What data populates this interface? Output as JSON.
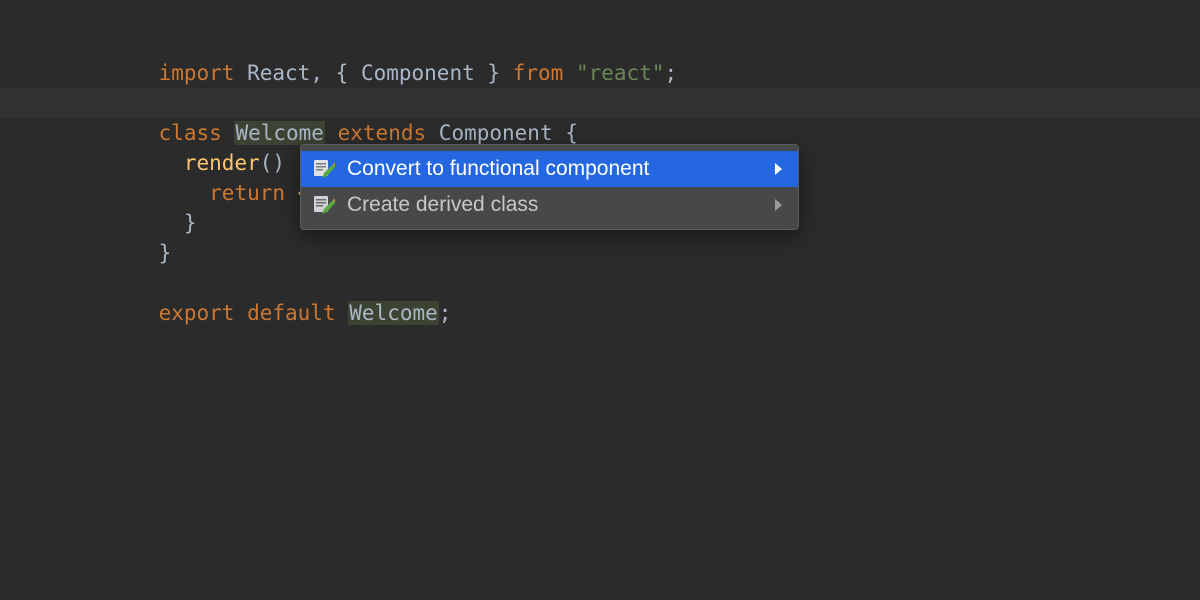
{
  "code": {
    "l1": {
      "kw_import": "import",
      "react": "React",
      "comma": ",",
      "lb": "{",
      "component": "Component",
      "rb": "}",
      "kw_from": "from",
      "str": "\"react\"",
      "semi": ";"
    },
    "l3": {
      "kw_class": "class",
      "name": "Welcome",
      "kw_extends": "extends",
      "super": "Component",
      "lb": "{"
    },
    "l4": {
      "method": "render",
      "parens": "()",
      "lb": "{"
    },
    "l5": {
      "kw_return": "return",
      "jsx": "<h"
    },
    "l6": {
      "rb": "}"
    },
    "l7": {
      "rb": "}"
    },
    "l9": {
      "kw_export": "export",
      "kw_default": "default",
      "name": "Welcome",
      "semi": ";"
    }
  },
  "menu": {
    "items": [
      {
        "label": "Convert to functional component",
        "selected": true
      },
      {
        "label": "Create derived class",
        "selected": false
      }
    ]
  }
}
